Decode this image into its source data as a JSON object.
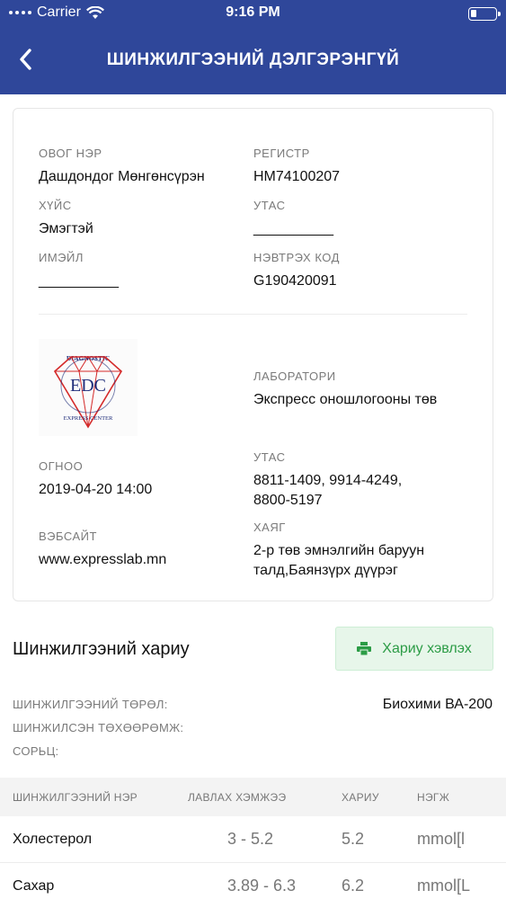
{
  "status_bar": {
    "carrier": "Carrier",
    "time": "9:16 PM"
  },
  "nav": {
    "title": "ШИНЖИЛГЭЭНИЙ ДЭЛГЭРЭНГҮЙ"
  },
  "patient": {
    "name_label": "ОВОГ НЭР",
    "name": "Дашдондог Мөнгөнсүрэн",
    "register_label": "РЕГИСТР",
    "register": "НМ74100207",
    "gender_label": "ХҮЙС",
    "gender": "Эмэгтэй",
    "phone_label": "УТАС",
    "phone": "__________",
    "email_label": "ИМЭЙЛ",
    "email": "__________",
    "login_code_label": "НЭВТРЭХ КОД",
    "login_code": "G190420091"
  },
  "lab": {
    "logo_text_top": "DIAGNOSTIC",
    "logo_letters": "EDC",
    "logo_text_ring": "EXPRESS CENTER",
    "lab_label": "ЛАБОРАТОРИ",
    "lab_name": "Экспресс оношлогооны төв",
    "date_label": "ОГНОО",
    "date": "2019-04-20 14:00",
    "phone_label": "УТАС",
    "phone": "8811-1409, 9914-4249, 8800-5197",
    "website_label": "ВЭБСАЙТ",
    "website": "www.expresslab.mn",
    "address_label": "ХАЯГ",
    "address": "2-р төв эмнэлгийн баруун талд,Баянзүрх дүүрэг"
  },
  "result": {
    "title": "Шинжилгээний хариу",
    "print_label": "Хариу хэвлэх",
    "type_label": "ШИНЖИЛГЭЭНИЙ ТӨРӨЛ:",
    "type_value": "Биохими ВА-200",
    "device_label": "ШИНЖИЛСЭН ТӨХӨӨРӨМЖ:",
    "sample_label": "СОРЬЦ:"
  },
  "table": {
    "headers": [
      "ШИНЖИЛГЭЭНИЙ НЭР",
      "ЛАВЛАХ ХЭМЖЭЭ",
      "ХАРИУ",
      "НЭГЖ"
    ],
    "rows": [
      {
        "name": "Холестерол",
        "ref": "3 - 5.2",
        "result": "5.2",
        "unit": "mmol[l"
      },
      {
        "name": "Сахар",
        "ref": "3.89 - 6.3",
        "result": "6.2",
        "unit": "mmol[L"
      }
    ]
  },
  "colors": {
    "header_bg": "#2f479a",
    "print_button_bg": "#e7f6ea",
    "print_button_text": "#2c9c46"
  }
}
